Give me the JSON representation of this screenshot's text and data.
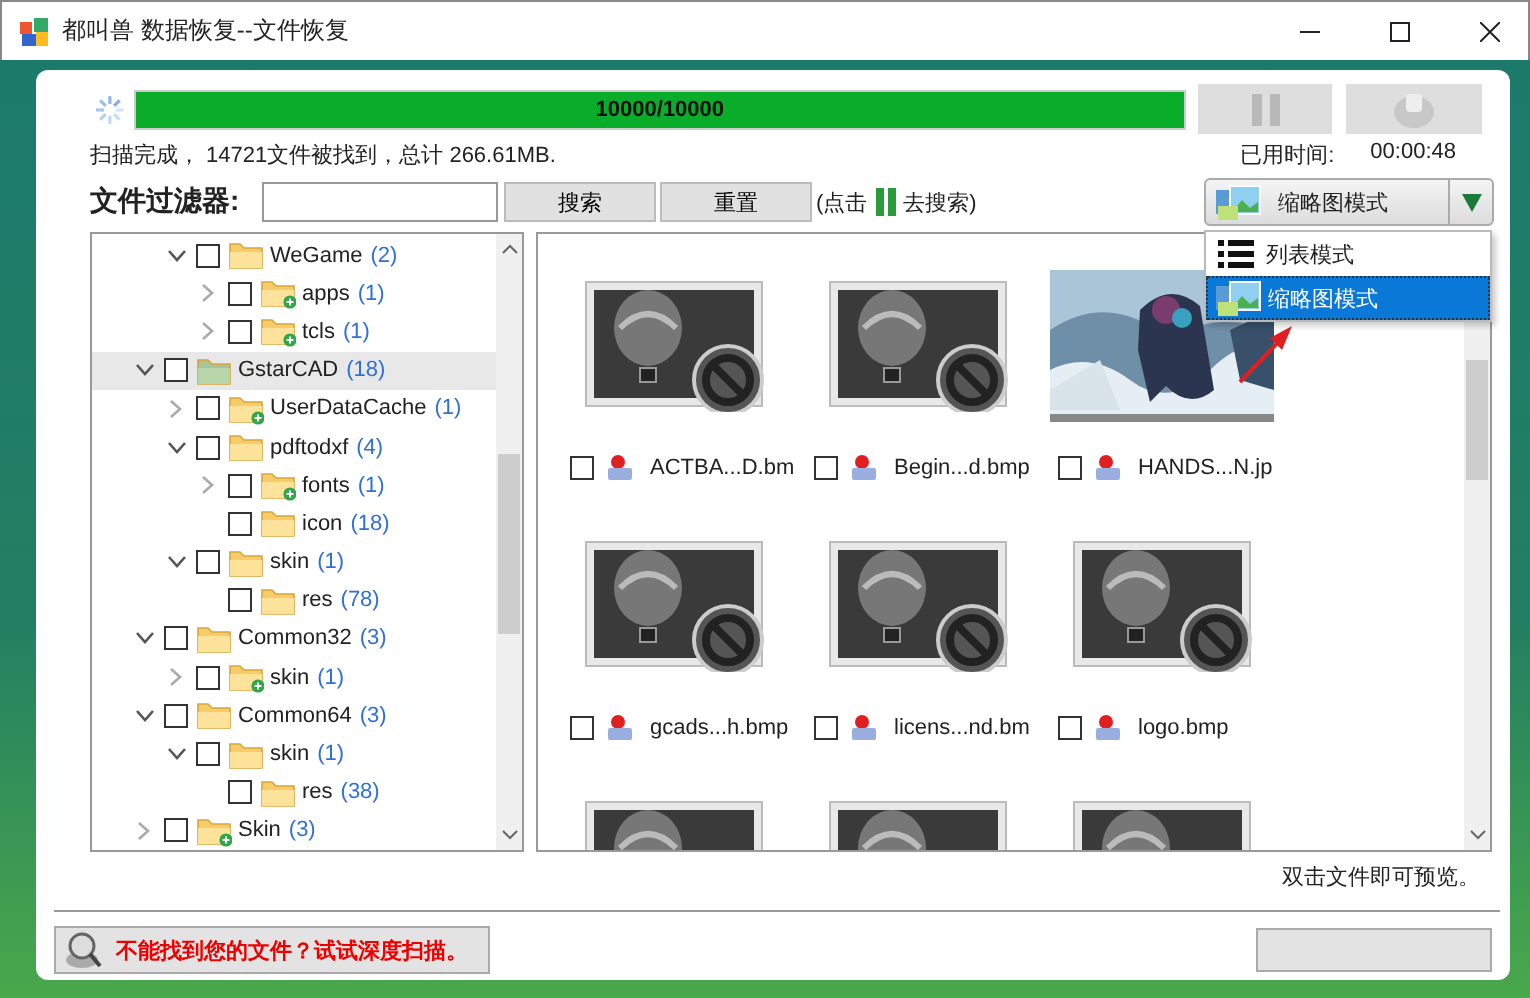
{
  "window": {
    "title": "都叫兽 数据恢复--文件恢复"
  },
  "scan": {
    "progress_text": "10000/10000",
    "level": 1.0,
    "status": "扫描完成， 14721文件被找到，总计 266.61MB.",
    "elapsed_label": "已用时间:",
    "elapsed": "00:00:48"
  },
  "filter": {
    "label": "文件过滤器:",
    "buttons": [
      "搜索",
      "重置"
    ],
    "hint_before": "(点击",
    "hint_after": "去搜索)"
  },
  "view_mode": {
    "current": "缩略图模式",
    "expanded": true,
    "options": [
      {
        "label": "列表模式",
        "kind": "list",
        "selected": false
      },
      {
        "label": "缩略图模式",
        "kind": "thumbnail",
        "selected": true
      }
    ]
  },
  "tree": [
    {
      "children": [
        {
          "name": "WeGame",
          "count": "(2)",
          "expanded": true,
          "checked": false,
          "selected": false,
          "marked": false,
          "children": [
            {
              "name": "apps",
              "count": "(1)",
              "expanded": false,
              "checked": false,
              "selected": false,
              "marked": true
            },
            {
              "name": "tcls",
              "count": "(1)",
              "expanded": false,
              "checked": false,
              "selected": false,
              "marked": true
            }
          ]
        }
      ]
    },
    {
      "name": "GstarCAD",
      "count": "(18)",
      "expanded": true,
      "checked": false,
      "selected": true,
      "marked": false,
      "children": [
        {
          "name": "UserDataCache",
          "count": "(1)",
          "expanded": false,
          "checked": false,
          "selected": false,
          "marked": true
        },
        {
          "name": "pdftodxf",
          "count": "(4)",
          "expanded": true,
          "checked": false,
          "selected": false,
          "marked": false,
          "children": [
            {
              "name": "fonts",
              "count": "(1)",
              "expanded": false,
              "checked": false,
              "selected": false,
              "marked": true
            },
            {
              "name": "icon",
              "count": "(18)",
              "checked": false,
              "selected": false,
              "marked": false
            }
          ]
        },
        {
          "name": "skin",
          "count": "(1)",
          "expanded": true,
          "checked": false,
          "selected": false,
          "marked": false,
          "children": [
            {
              "name": "res",
              "count": "(78)",
              "checked": false,
              "selected": false,
              "marked": false
            }
          ]
        }
      ]
    },
    {
      "name": "Common32",
      "count": "(3)",
      "expanded": true,
      "checked": false,
      "selected": false,
      "marked": false,
      "children": [
        {
          "name": "skin",
          "count": "(1)",
          "expanded": false,
          "checked": false,
          "selected": false,
          "marked": true
        }
      ]
    },
    {
      "name": "Common64",
      "count": "(3)",
      "expanded": true,
      "checked": false,
      "selected": false,
      "marked": false,
      "children": [
        {
          "name": "skin",
          "count": "(1)",
          "expanded": true,
          "checked": false,
          "selected": false,
          "marked": false,
          "children": [
            {
              "name": "res",
              "count": "(38)",
              "checked": false,
              "selected": false,
              "marked": false
            }
          ]
        }
      ]
    },
    {
      "name": "Skin",
      "count": "(3)",
      "expanded": false,
      "checked": false,
      "selected": false,
      "marked": true
    }
  ],
  "files": [
    {
      "name": "ACTBA...D.bm",
      "kind": "broken",
      "checked": false
    },
    {
      "name": "Begin...d.bmp",
      "kind": "broken",
      "checked": false
    },
    {
      "name": "HANDS...N.jp",
      "kind": "picture",
      "checked": false
    },
    {
      "name": "gcads...h.bmp",
      "kind": "broken",
      "checked": false
    },
    {
      "name": "licens...nd.bm",
      "kind": "broken",
      "checked": false
    },
    {
      "name": "logo.bmp",
      "kind": "broken",
      "checked": false
    },
    {
      "kind": "broken"
    },
    {
      "kind": "broken"
    },
    {
      "kind": "broken"
    }
  ],
  "preview_hint": "双击文件即可预览。",
  "deep_scan": {
    "label": "不能找到您的文件？试试深度扫描。"
  }
}
